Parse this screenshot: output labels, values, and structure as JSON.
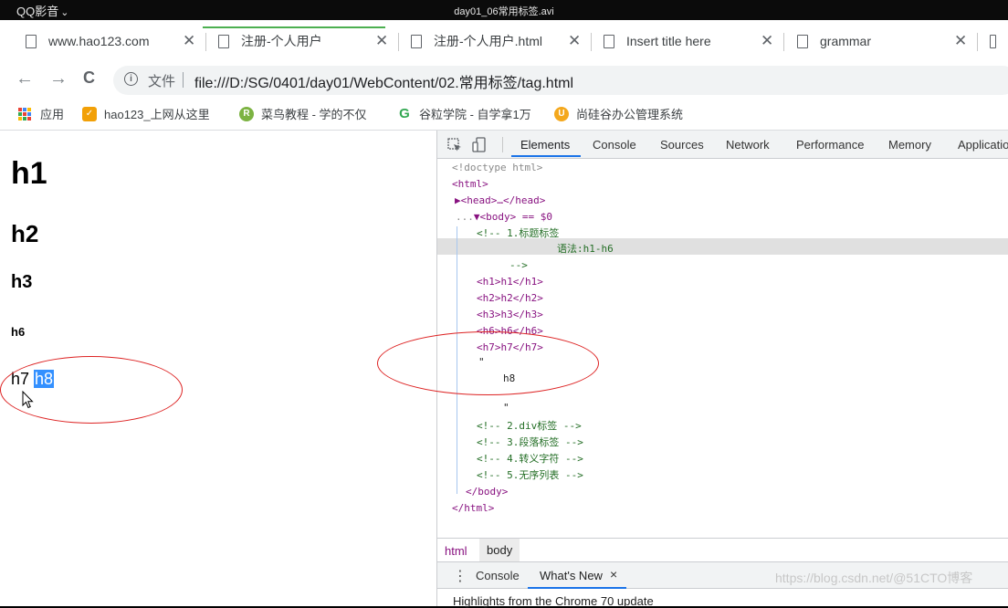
{
  "player": {
    "app_name": "QQ影音",
    "chevron": "⌄",
    "file_title": "day01_06常用标签.avi"
  },
  "tabs": [
    {
      "title": "www.hao123.com",
      "icon": "doc-icon"
    },
    {
      "title": "注册-个人用户",
      "icon": "doc-icon"
    },
    {
      "title": "注册-个人用户.html",
      "icon": "doc-icon"
    },
    {
      "title": "Insert title here",
      "icon": "doc-icon"
    },
    {
      "title": "grammar",
      "icon": "doc-icon"
    }
  ],
  "tab_close_glyph": "✕",
  "nav": {
    "back": "←",
    "forward": "→",
    "reload": "C",
    "info": "i",
    "scheme_label": "文件",
    "url": "file:///D:/SG/0401/day01/WebContent/02.常用标签/tag.html"
  },
  "bookmarks": [
    {
      "label": "应用",
      "icon": "apps-icon"
    },
    {
      "label": "hao123_上网从这里",
      "icon": "hao123-icon"
    },
    {
      "label": "菜鸟教程 - 学的不仅",
      "icon": "runoob-icon"
    },
    {
      "label": "谷粒学院 - 自学拿1万",
      "icon": "guli-icon"
    },
    {
      "label": "尚硅谷办公管理系统",
      "icon": "atguigu-icon"
    }
  ],
  "page": {
    "h1": "h1",
    "h2": "h2",
    "h3": "h3",
    "h6": "h6",
    "h7": "h7",
    "h8_selected": "h8"
  },
  "devtools": {
    "tabs": [
      "Elements",
      "Console",
      "Sources",
      "Network",
      "Performance",
      "Memory",
      "Applicatio"
    ],
    "dom_lines": [
      {
        "t": "<!doctype html>"
      },
      {
        "t": "<html>"
      },
      {
        "t": "▶<head>…</head>"
      },
      {
        "t": "▼<body> == $0",
        "prefix": "..."
      },
      {
        "t": "<!-- 1.标题标签"
      },
      {
        "t": "语法:h1-h6"
      },
      {
        "t": "-->"
      },
      {
        "t": "<h1>h1</h1>"
      },
      {
        "t": "<h2>h2</h2>"
      },
      {
        "t": "<h3>h3</h3>"
      },
      {
        "t": "<h6>h6</h6>"
      },
      {
        "t": "<h7>h7</h7>"
      },
      {
        "t": "\""
      },
      {
        "t": "h8"
      },
      {
        "t": "\""
      },
      {
        "t": "<!-- 2.div标签 -->"
      },
      {
        "t": "<!-- 3.段落标签 -->"
      },
      {
        "t": "<!-- 4.转义字符 -->"
      },
      {
        "t": "<!-- 5.无序列表 -->"
      },
      {
        "t": "</body>"
      },
      {
        "t": "</html>"
      }
    ],
    "breadcrumbs": [
      "html",
      "body"
    ],
    "drawer": {
      "menu": "⋮",
      "console_tab": "Console",
      "whats_new_tab": "What's New",
      "close": "×"
    },
    "highlights_text": "Highlights from the Chrome 70 update"
  },
  "watermark": "https://blog.csdn.net/@51CTO博客"
}
